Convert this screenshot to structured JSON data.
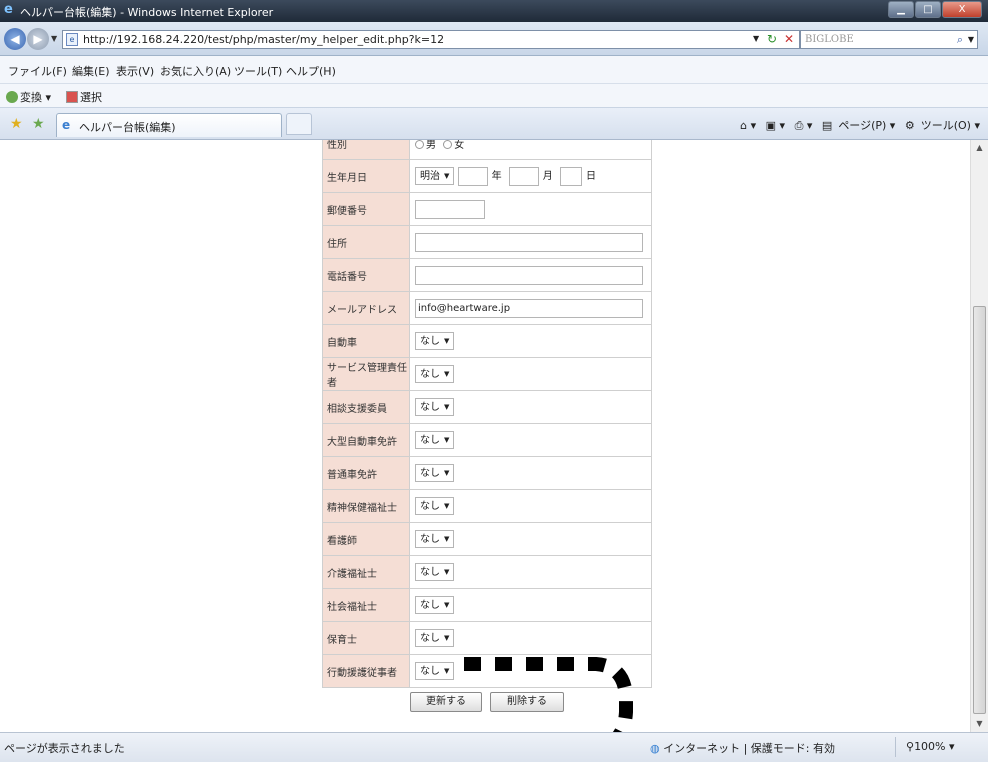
{
  "window": {
    "title": "ヘルパー台帳(編集) - Windows Internet Explorer",
    "minimize": "▁",
    "maximize": "□",
    "close": "X"
  },
  "address": {
    "url": "http://192.168.24.220/test/php/master/my_helper_edit.php?k=12",
    "search_placeholder": "BIGLOBE"
  },
  "menu": [
    "ファイル(F)",
    "編集(E)",
    "表示(V)",
    "お気に入り(A)",
    "ツール(T)",
    "ヘルプ(H)"
  ],
  "links": {
    "convert": "変換",
    "select": "選択"
  },
  "tab": {
    "label": "ヘルパー台帳(編集)"
  },
  "commandbar": {
    "page": "ページ(P)",
    "tools": "ツール(O)"
  },
  "form": {
    "gender": {
      "label": "性別",
      "options": [
        "男",
        "女"
      ]
    },
    "birth": {
      "label": "生年月日",
      "era": "明治",
      "year_unit": "年",
      "month_unit": "月",
      "day_unit": "日"
    },
    "postal": {
      "label": "郵便番号",
      "value": ""
    },
    "address": {
      "label": "住所",
      "value": ""
    },
    "phone": {
      "label": "電話番号",
      "value": ""
    },
    "email": {
      "label": "メールアドレス",
      "value": "info@heartware.jp"
    },
    "rows": [
      {
        "label": "自動車",
        "value": "なし"
      },
      {
        "label": "サービス管理責任者",
        "value": "なし"
      },
      {
        "label": "相談支援委員",
        "value": "なし"
      },
      {
        "label": "大型自動車免許",
        "value": "なし"
      },
      {
        "label": "普通車免許",
        "value": "なし"
      },
      {
        "label": "精神保健福祉士",
        "value": "なし"
      },
      {
        "label": "看護師",
        "value": "なし"
      },
      {
        "label": "介護福祉士",
        "value": "なし"
      },
      {
        "label": "社会福祉士",
        "value": "なし"
      },
      {
        "label": "保育士",
        "value": "なし"
      },
      {
        "label": "行動援護従事者",
        "value": "なし"
      }
    ],
    "update_button": "更新する",
    "delete_button": "削除する"
  },
  "status": {
    "text": "ページが表示されました",
    "zone": "インターネット | 保護モード: 有効",
    "zoom": "100%"
  }
}
